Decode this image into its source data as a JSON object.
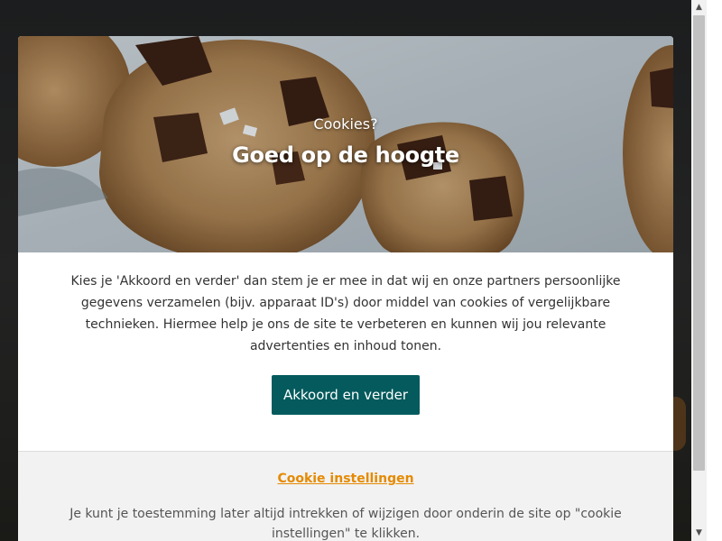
{
  "hero": {
    "subtitle": "Cookies?",
    "title": "Goed op de hoogte"
  },
  "consent": {
    "body": "Kies je 'Akkoord en verder' dan stem je er mee in dat wij en onze partners persoonlijke gegevens verzamelen (bijv. apparaat ID's) door middel van cookies of vergelijkbare technieken. Hiermee help je ons de site te verbeteren en kunnen wij jou relevante advertenties en inhoud tonen.",
    "accept_label": "Akkoord en verder"
  },
  "footer": {
    "settings_link": "Cookie instellingen",
    "note": "Je kunt je toestemming later altijd intrekken of wijzigen door onderin de site op \"cookie instellingen\" te klikken."
  },
  "colors": {
    "accept_button": "#045a5c",
    "settings_link": "#e58a00"
  },
  "icons": {
    "scroll_up": "triangle-up-icon",
    "scroll_down": "triangle-down-icon"
  }
}
